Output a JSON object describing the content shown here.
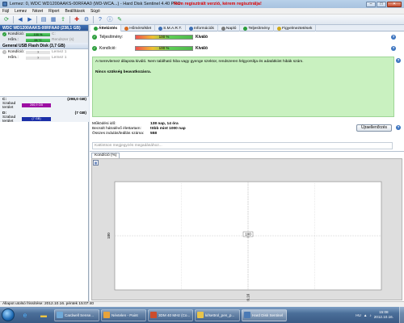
{
  "window": {
    "title": "Lemez: 0, WDC WD1200AAKS-00RFAA0 (WD-WCA...) - Hard Disk Sentinel 4.40 PRO",
    "notice": "Nem regisztrált verzió, kérem regisztrálja!",
    "buttons": {
      "min": "–",
      "max": "□",
      "close": "✕"
    }
  },
  "menu": [
    "Fájl",
    "Lemez",
    "Nézet",
    "Riport",
    "Beállítások",
    "Súgó"
  ],
  "toolbar": {
    "icons": [
      "refresh-icon",
      "back-icon",
      "forward-icon",
      "disk-icon",
      "report-icon",
      "export-icon",
      "test-icon",
      "settings-icon",
      "help-icon",
      "info-icon",
      "register-icon"
    ]
  },
  "left": {
    "disk1": {
      "header": "WDC WD1200AAKS-00RFAA0 (238,1 GB)",
      "rows": [
        {
          "label": "Kondíció:",
          "bar": "100 %",
          "extra": "C:"
        },
        {
          "label": "Hőm.:",
          "bar": "28 °C",
          "extra": "Rendszer (s)"
        }
      ]
    },
    "disk2": {
      "header": "General USB Flash Disk (3,7 GB)",
      "rows": [
        {
          "label": "Kondíció:",
          "bar": "?",
          "extra": "Lemez 1"
        },
        {
          "label": "Hőm.:",
          "bar": "?",
          "extra": "Lemez 1"
        }
      ]
    },
    "partitions": [
      {
        "name": "C:",
        "size": "(298,0 GB)",
        "label": "Szabad terület",
        "bar": "266,9 GB",
        "barColor": "#9d0fa3"
      },
      {
        "name": "D:",
        "size": "(7 GB)",
        "label": "Szabad terület",
        "bar": "(7 GB)",
        "barColor": "#1b2fa8"
      }
    ]
  },
  "tabs": [
    {
      "label": "Áttekintés",
      "icon": "overview-icon",
      "color": "#2a9d3a",
      "active": true
    },
    {
      "label": "Hőmérséklet",
      "icon": "temperature-icon",
      "color": "#d76a1f",
      "active": false
    },
    {
      "label": "S.M.A.R.T.",
      "icon": "smart-icon",
      "color": "#3d6fb4",
      "active": false
    },
    {
      "label": "Információk",
      "icon": "info-icon",
      "color": "#3d6fb4",
      "active": false
    },
    {
      "label": "Napló",
      "icon": "log-icon",
      "color": "#7a7a7a",
      "active": false
    },
    {
      "label": "Teljesítmény",
      "icon": "performance-icon",
      "color": "#2a9d3a",
      "active": false
    },
    {
      "label": "Figyelmeztetések",
      "icon": "alerts-icon",
      "color": "#d0a91a",
      "active": false
    }
  ],
  "overview": {
    "performance": {
      "label": "Teljesítmény:",
      "bar": "100 %",
      "value": "Kiváló",
      "percent": 100
    },
    "health": {
      "label": "Kondíció:",
      "bar": "100 %",
      "value": "Kiváló",
      "percent": 100
    },
    "status_text": "A merevlemez állapota kiváló. Nem található hiba vagy gyenge szektor, rendszeren felgyorsítja és adatátkiint hibák szám.",
    "action": "Nincs szükség beavatkozásra.",
    "info": [
      {
        "key": "Működési idő:",
        "value": "138 nap, 14 óra"
      },
      {
        "key": "Becsült hátralévő élettartam:",
        "value": "több mint 1000 nap"
      },
      {
        "key": "Összes indulás/leállás száma:",
        "value": "558"
      }
    ],
    "update_button": "Újraellenőrzés",
    "comment_placeholder": "Kattintson megjegyzés megadásához..."
  },
  "chart_data": {
    "type": "line",
    "tab": "Kondíció (%)",
    "x": [
      "2012.10.16"
    ],
    "series": [
      {
        "values": [
          100
        ]
      }
    ],
    "ylabel": "100",
    "ylim": [
      0,
      100
    ],
    "grid": true
  },
  "statusbar": "Állapot utolsó frissítése: 2012.10.16. péntek 15:07:40",
  "taskbar": {
    "tasks": [
      {
        "label": "Cardwell Sense...",
        "color": "#6fa9d8",
        "active": false
      },
      {
        "label": "Névtelen - Paint",
        "color": "#e7a33a",
        "active": false
      },
      {
        "label": "3DM 40 MHz (Co...",
        "color": "#cc4d2d",
        "active": false
      },
      {
        "label": "kifsettrol_pen_p...",
        "color": "#e8c44a",
        "active": false
      },
      {
        "label": "Hard Disk Sentinel",
        "color": "#4a7ab5",
        "active": true
      }
    ],
    "lang": "HU",
    "time": "15:08",
    "date": "2012.10.16."
  }
}
